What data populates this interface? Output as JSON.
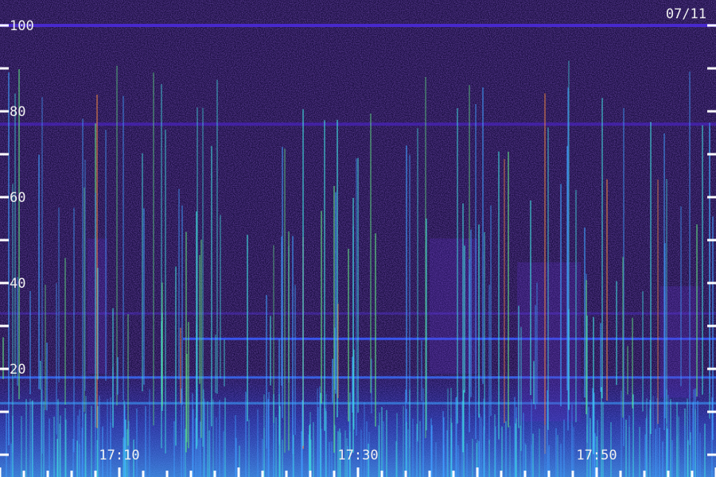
{
  "chart_data": {
    "type": "heatmap",
    "title": "",
    "date_label": "07/11",
    "xlabel": "",
    "ylabel": "",
    "y_range": [
      0,
      100
    ],
    "y_tick_labels": [
      "20",
      "40",
      "60",
      "80",
      "100"
    ],
    "y_tick_values": [
      20,
      40,
      60,
      80,
      100
    ],
    "x_range_minutes": [
      0,
      60
    ],
    "x_tick_labels": [
      "17:10",
      "17:30",
      "17:50"
    ],
    "x_tick_values_minutes": [
      10,
      30,
      50
    ],
    "colors": {
      "background": "#1a0f3a",
      "noise_low": "#2a1260",
      "noise_high": "#5a2ab8",
      "band": "#3a5cff",
      "streak_blue": "#3fa0ff",
      "streak_cyan": "#40e0e0",
      "streak_green": "#60e080",
      "streak_orange": "#ff9040",
      "axis_ticks": "#ffffff"
    },
    "grid": false,
    "legend": "none"
  }
}
